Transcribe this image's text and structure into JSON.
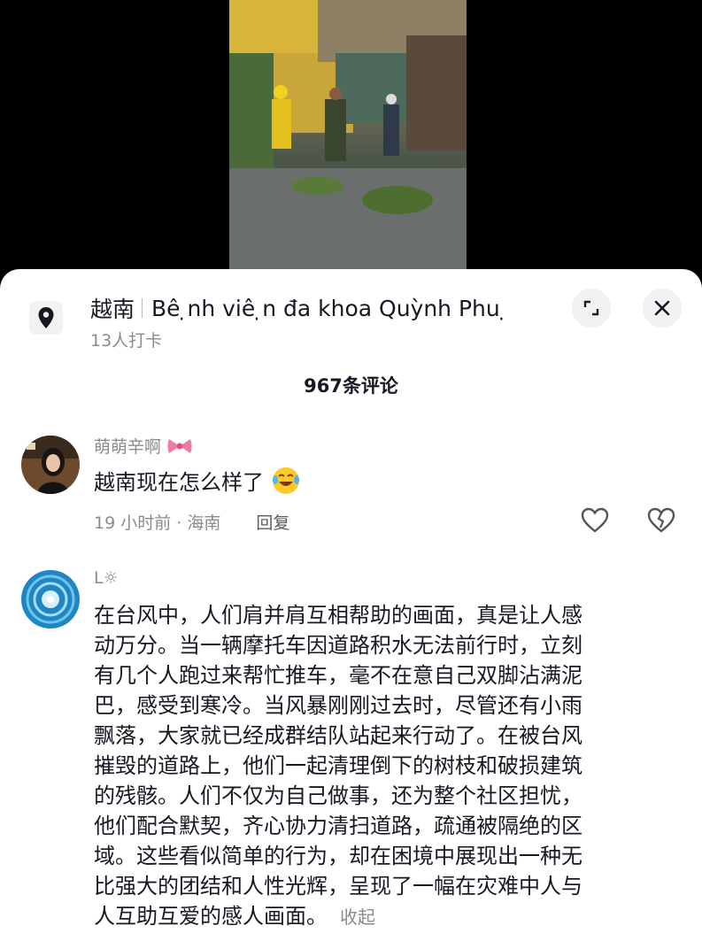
{
  "location": {
    "country": "越南",
    "place": "Bê ̣nh viê ̣n đa khoa Quỳnh Phu ̣",
    "checkins": "13人打卡"
  },
  "comments_header": {
    "count_label": "967条评论"
  },
  "comments": [
    {
      "username": "萌萌辛啊",
      "text": "越南现在怎么样了",
      "meta": "19 小时前 · 海南",
      "reply_label": "回复"
    },
    {
      "username": "L☼",
      "lines": [
        "在台风中，人们肩并肩互相帮助的画面，真是让人感",
        "动万分。当一辆摩托车因道路积水无法前行时，立刻",
        "有几个人跑过来帮忙推车，毫不在意自己双脚沾满泥",
        "巴，感受到寒冷。当风暴刚刚过去时，尽管还有小雨",
        "飘落，大家就已经成群结队站起来行动了。在被台风",
        "摧毁的道路上，他们一起清理倒下的树枝和破损建筑",
        "的残骸。人们不仅为自己做事，还为整个社区担忧，",
        "他们配合默契，齐心协力清扫道路，疏通被隔绝的区",
        "域。这些看似简单的行为，却在困境中展现出一种无",
        "比强大的团结和人性光辉，呈现了一幅在灾难中人与",
        "人互助互爱的感人画面。"
      ],
      "collapse_label": "收起"
    }
  ]
}
